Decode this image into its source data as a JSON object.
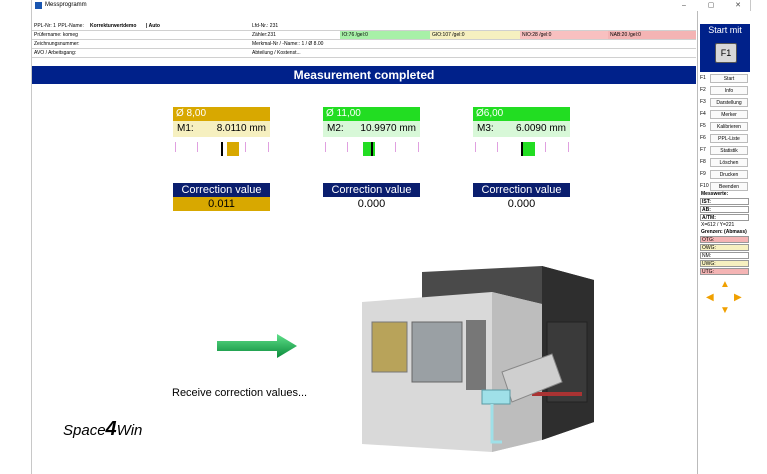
{
  "window": {
    "title": "Messprogramm",
    "minimize": "–",
    "maximize": "▢",
    "close": "✕"
  },
  "info": {
    "row0": {
      "ppl_nr": "PPL-Nr: 1",
      "ppl_name_label": "PPL-Name:",
      "ppl_name": "Korrekturwertdemo",
      "mode": "| Auto",
      "lfd_nr": "Lfd-Nr.: 231"
    },
    "row1": {
      "pruefername": "Prüfername: komeg",
      "zaehler": "Zähler:231",
      "io": "IO:76 /gel:0",
      "gio": "GIO:107 /gel:0",
      "nio": "NIO:28 /gel:0",
      "nab": "NAB:20 /gel:0"
    },
    "row2": {
      "zeichnungsnummer": "Zeichnungsnummer:",
      "merkmal": "Merkmal-Nr / -Name:: 1 / Ø 8.00"
    },
    "row3": {
      "avo": "AVO / Arbeitsgang:",
      "abteilung": "Abteilung / Kostenst..."
    }
  },
  "banner": "Measurement completed",
  "measurements": [
    {
      "nominal": "Ø 8,00",
      "label": "M1:",
      "value": "8.0110 mm",
      "color": "#d8a800",
      "level": 0.62
    },
    {
      "nominal": "Ø 11,00",
      "label": "M2:",
      "value": "10.9970 mm",
      "color": "#22dd22",
      "level": 0.47
    },
    {
      "nominal": "Ø6,00",
      "label": "M3:",
      "value": "6.0090 mm",
      "color": "#22dd22",
      "level": 0.58
    }
  ],
  "corrections": [
    {
      "heading": "Correction value",
      "value": "0.011",
      "highlight": "#d8a800"
    },
    {
      "heading": "Correction value",
      "value": "0.000",
      "highlight": "#ffffff"
    },
    {
      "heading": "Correction value",
      "value": "0.000",
      "highlight": "#ffffff"
    }
  ],
  "start": {
    "title": "Start mit",
    "key": "F1"
  },
  "fkeys": [
    {
      "key": "F1",
      "label": "Start"
    },
    {
      "key": "F2",
      "label": "Info"
    },
    {
      "key": "F3",
      "label": "Darstellung"
    },
    {
      "key": "F4",
      "label": "Merker"
    },
    {
      "key": "F5",
      "label": "Kalibrieren"
    },
    {
      "key": "F6",
      "label": "PPL-Liste"
    },
    {
      "key": "F7",
      "label": "Statistik"
    },
    {
      "key": "F8",
      "label": "Löschen"
    },
    {
      "key": "F9",
      "label": "Drucken"
    },
    {
      "key": "F10",
      "label": "Beenden"
    }
  ],
  "messwerte": {
    "title": "Messwerte:",
    "ist": "IST:",
    "ab": "AB:",
    "atm": "A/TM:",
    "xy": "X=612 / Y=221",
    "grenzen": "Grenzen: (Abmass)",
    "otg": "OTG:",
    "owg": "OWG:",
    "nm": "NM:",
    "uwg": "UWG:",
    "utg": "UTG:"
  },
  "colors": {
    "otg": "#f4b4b4",
    "owg": "#f6f0c0",
    "nm": "#ffffff",
    "uwg": "#f6f0c0",
    "utg": "#f4b4b4"
  },
  "receive_text": "Receive correction values...",
  "logo": {
    "space": "Space",
    "four": "4",
    "win": "Win"
  }
}
